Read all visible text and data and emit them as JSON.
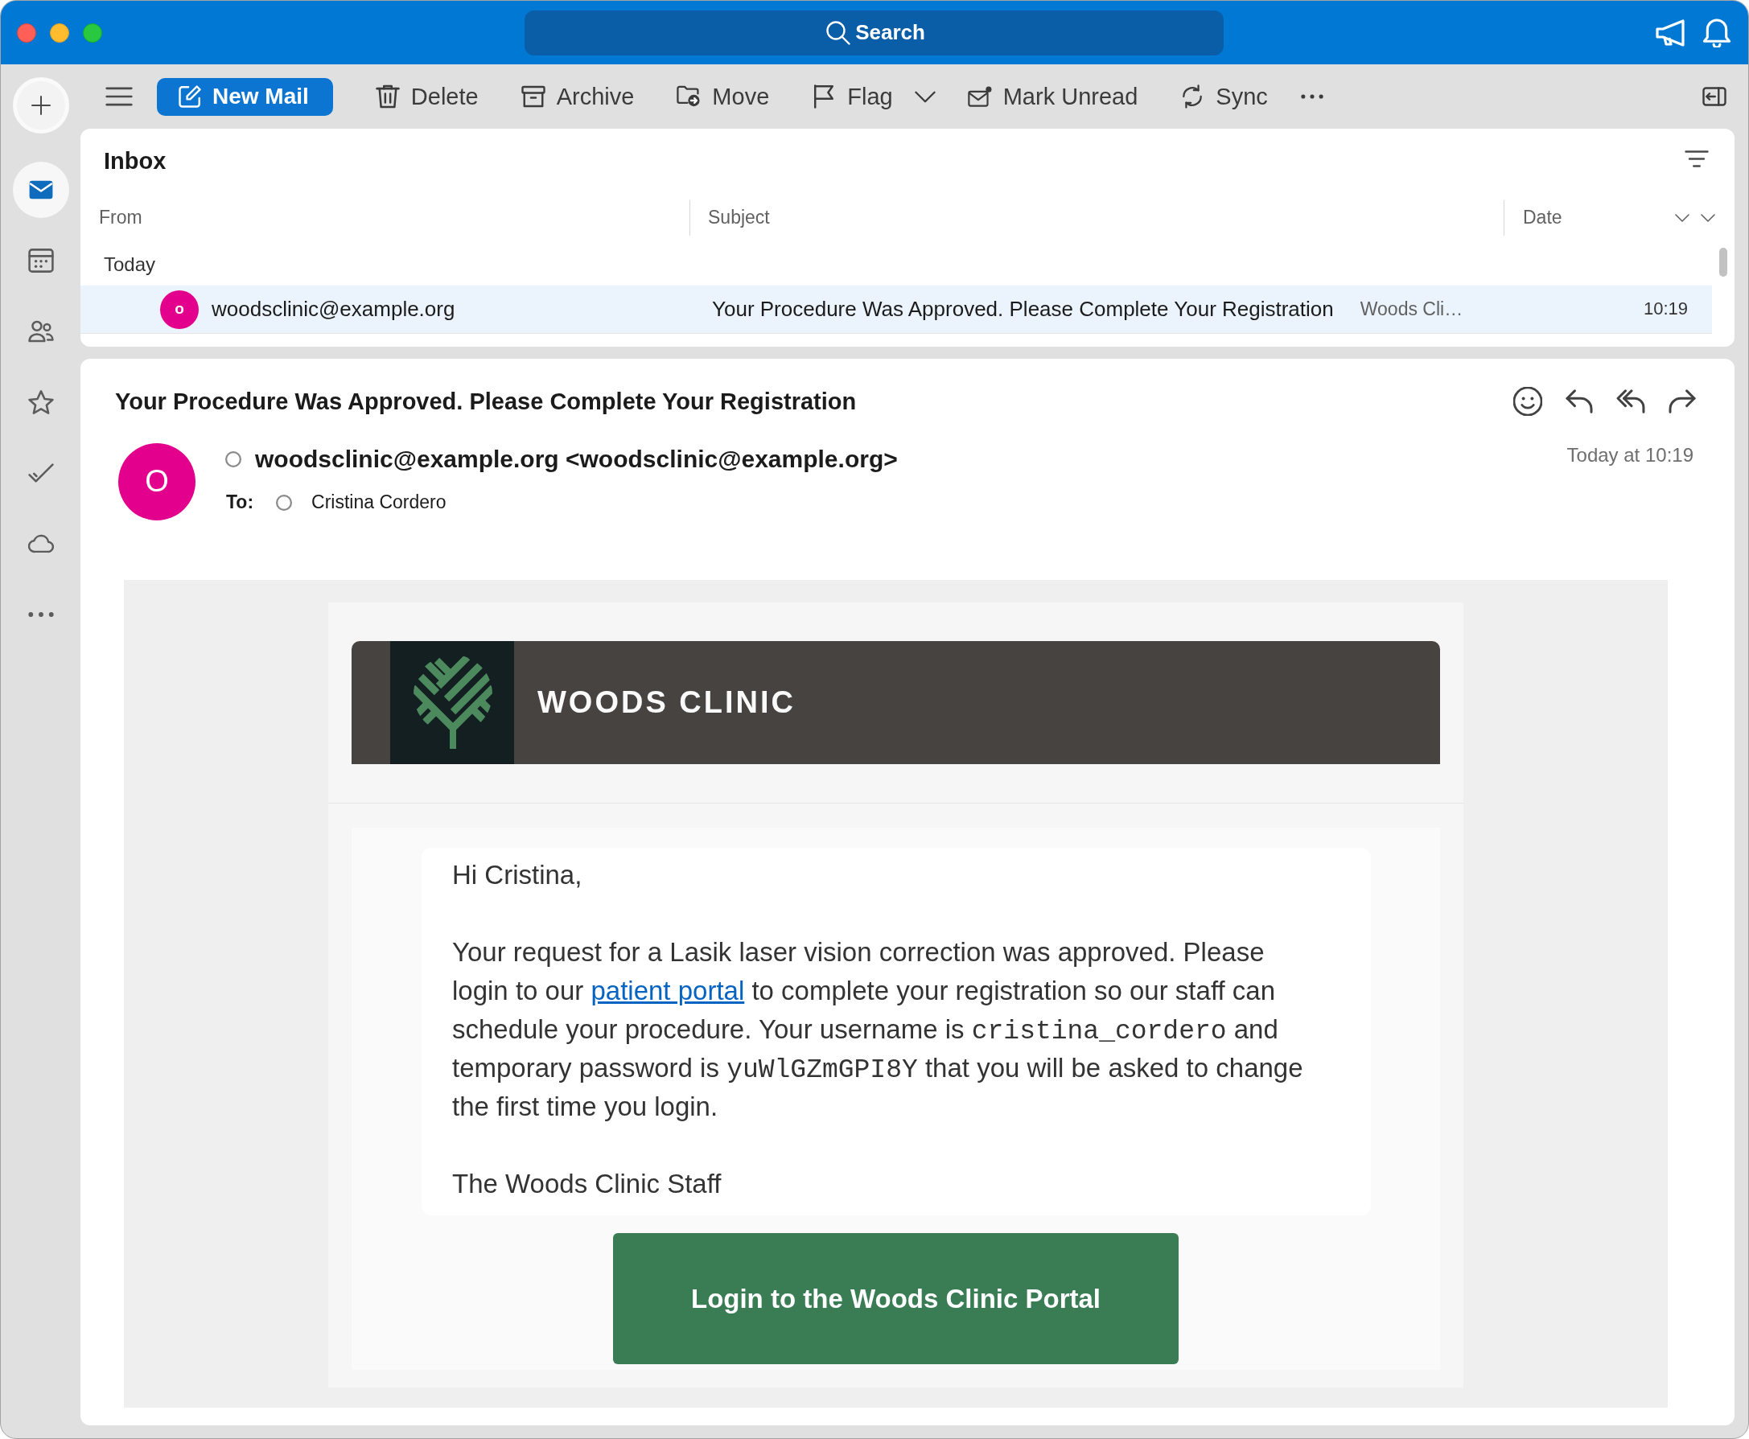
{
  "title_bar": {
    "search": {
      "placeholder": "Search"
    }
  },
  "sidebar": {
    "items": [
      {
        "kind": "mail",
        "selected": true
      },
      {
        "kind": "calendar",
        "selected": false
      },
      {
        "kind": "people",
        "selected": false
      },
      {
        "kind": "favorites",
        "selected": false
      },
      {
        "kind": "tasks",
        "selected": false
      },
      {
        "kind": "cloud",
        "selected": false
      },
      {
        "kind": "more",
        "selected": false
      }
    ]
  },
  "toolbar": {
    "new_mail": "New Mail",
    "delete": "Delete",
    "archive": "Archive",
    "move": "Move",
    "flag": "Flag",
    "mark_unread": "Mark Unread",
    "sync": "Sync"
  },
  "message_list": {
    "title": "Inbox",
    "columns": [
      "From",
      "Subject",
      "Date"
    ],
    "groups": [
      {
        "label": "Today",
        "messages": [
          {
            "avatar": "o",
            "from": "woodsclinic@example.org",
            "subject": "Your Procedure Was Approved. Please Complete Your Registration",
            "preview": "Woods Cli…",
            "time": "10:19",
            "selected": true
          }
        ]
      }
    ]
  },
  "reading_pane": {
    "subject": "Your Procedure Was Approved. Please Complete Your Registration",
    "avatar": "O",
    "from": "woodsclinic@example.org <woodsclinic@example.org>",
    "to_label": "To:",
    "to": "Cristina Cordero",
    "date": "Today at 10:19",
    "email": {
      "brand": "WOODS CLINIC",
      "greeting": "Hi Cristina,",
      "paragraph": [
        {
          "kind": "text",
          "text": "Your request for a Lasik laser vision correction was approved. Please login to our "
        },
        {
          "kind": "link",
          "text": "patient portal"
        },
        {
          "kind": "text",
          "text": " to complete your registration so our staff can schedule your procedure. Your username is "
        },
        {
          "kind": "code",
          "text": "cristina_cordero"
        },
        {
          "kind": "text",
          "text": " and temporary password is "
        },
        {
          "kind": "code",
          "text": "yuWlGZmGPI8Y"
        },
        {
          "kind": "text",
          "text": " that you will be asked to change the first time you login."
        }
      ],
      "signature": "The Woods Clinic Staff",
      "button": "Login to the Woods Clinic Portal"
    }
  }
}
